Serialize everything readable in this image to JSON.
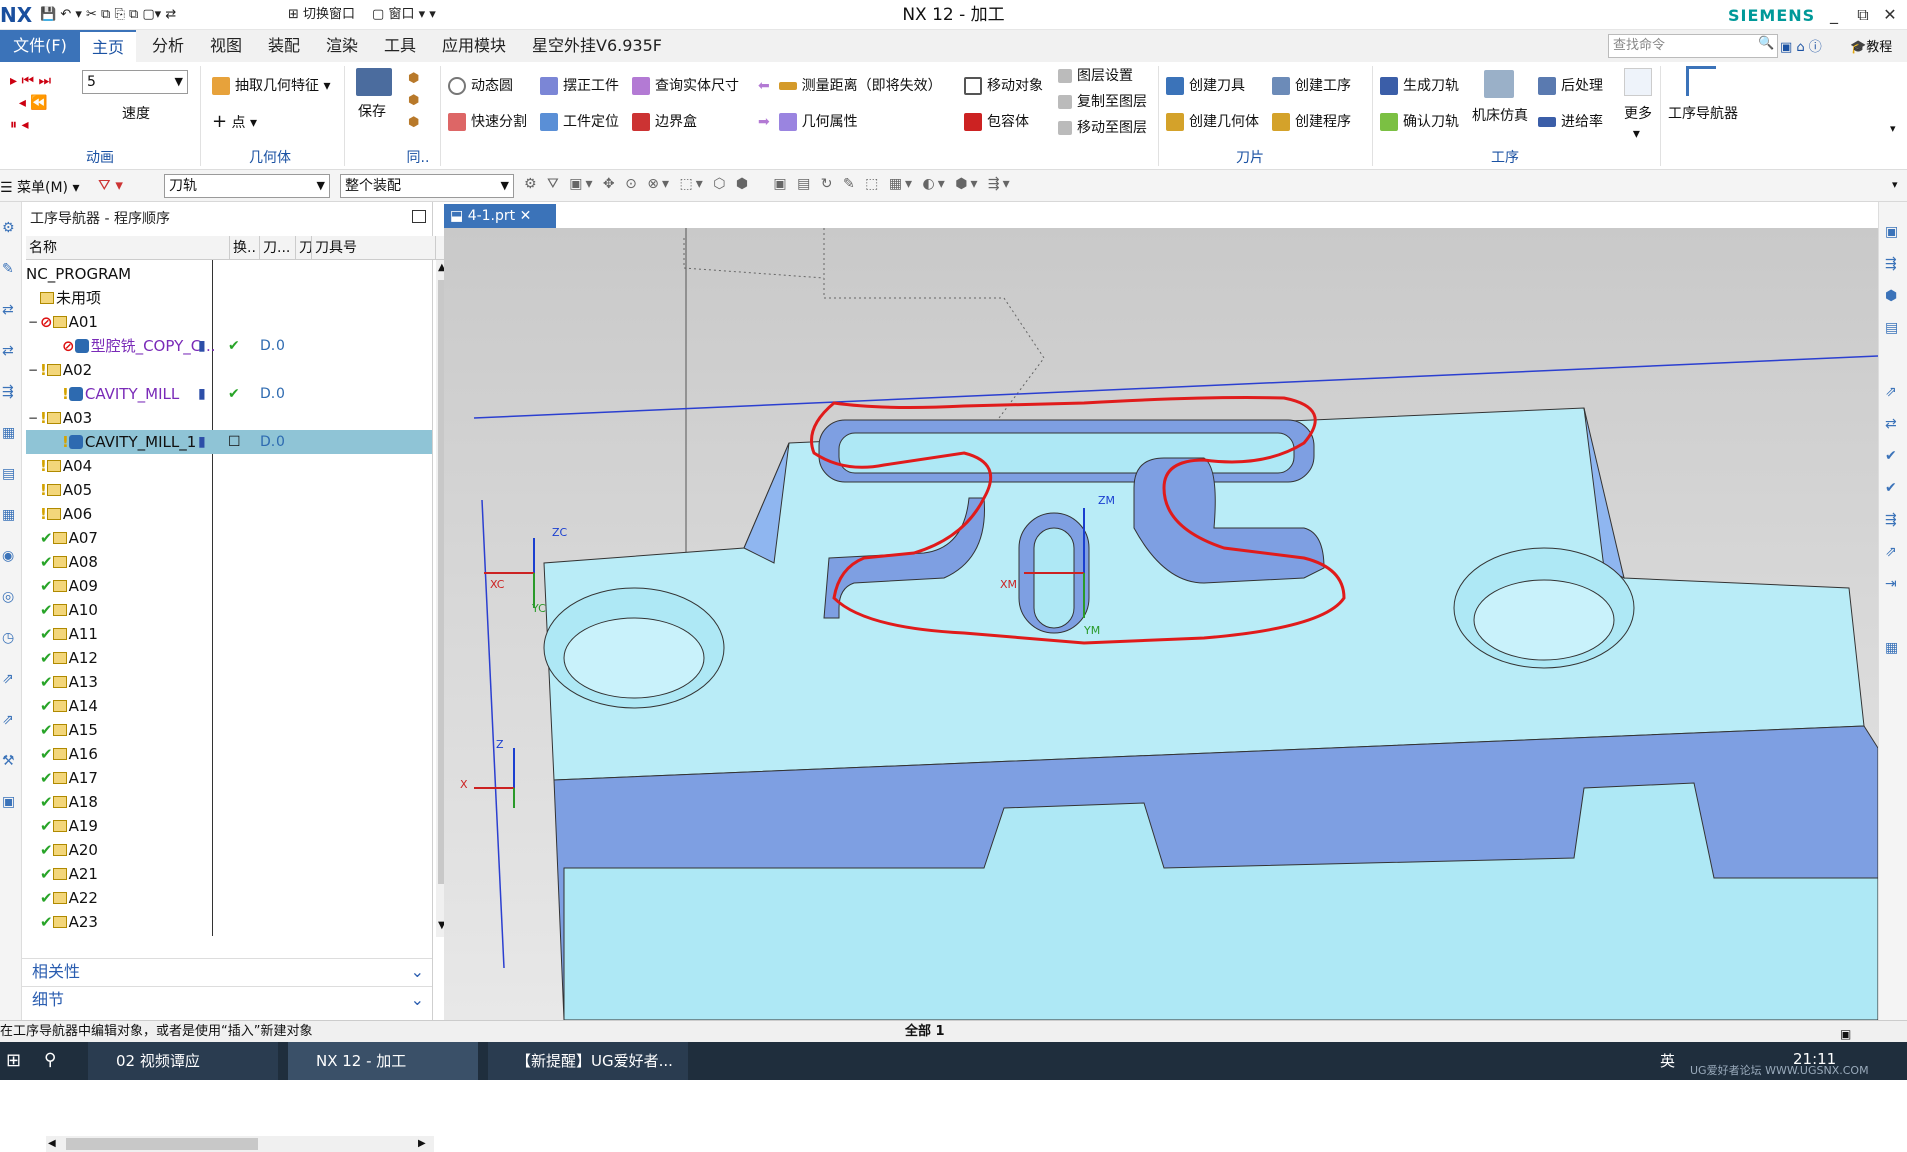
{
  "titlebar": {
    "logo": "NX",
    "switch_window": "切换窗口",
    "window_menu": "窗口",
    "title": "NX 12 - 加工",
    "brand": "SIEMENS",
    "minimize": "_",
    "restore": "⧉",
    "close": "✕"
  },
  "menu": {
    "file": "文件(F)",
    "tabs": [
      "主页",
      "分析",
      "视图",
      "装配",
      "渲染",
      "工具",
      "应用模块",
      "星空外挂V6.935F"
    ],
    "search_placeholder": "查找命令",
    "tutorial": "教程"
  },
  "ribbon": {
    "animation": {
      "speed_value": "5",
      "speed_label": "速度",
      "group": "动画"
    },
    "geometry": {
      "extract": "抽取几何特征",
      "point": "点",
      "group": "几何体"
    },
    "save": "保存",
    "sync_group": "同..",
    "tools": {
      "dynamic_circle": "动态圆",
      "place_part": "摆正工件",
      "query_size": "查询实体尺寸",
      "measure_distance": "测量距离（即将失效）",
      "move_object": "移动对象",
      "layer_settings": "图层设置",
      "quick_split": "快速分割",
      "part_locate": "工件定位",
      "bounding_box": "边界盒",
      "geom_props": "几何属性",
      "wrap_body": "包容体",
      "copy_to_layer": "复制至图层",
      "move_to_layer": "移动至图层"
    },
    "tool_group": {
      "create_tool": "创建刀具",
      "create_geometry": "创建几何体",
      "group": "刀片"
    },
    "operation": {
      "create_operation": "创建工序",
      "create_program": "创建程序",
      "generate_toolpath": "生成刀轨",
      "verify_toolpath": "确认刀轨",
      "machine_sim": "机床仿真",
      "postprocess": "后处理",
      "feed_rate": "进给率",
      "more": "更多",
      "group": "工序"
    },
    "navigator": "工序导航器"
  },
  "toolbar2": {
    "menu": "菜单(M)",
    "filter": "刀轨",
    "assembly": "整个装配"
  },
  "navigator": {
    "title": "工序导航器 - 程序顺序",
    "columns": [
      "名称",
      "换..",
      "刀...",
      "刀",
      "刀具号"
    ],
    "rows": [
      {
        "name": "NC_PROGRAM",
        "indent": 0,
        "kind": "root"
      },
      {
        "name": "未用项",
        "indent": 1,
        "kind": "folder"
      },
      {
        "name": "A01",
        "indent": 1,
        "kind": "folder",
        "status": "no",
        "expand": "−"
      },
      {
        "name": "型腔铣_COPY_C...",
        "indent": 2,
        "kind": "op",
        "status": "no",
        "tool_change": "▮",
        "path": "✔",
        "col3": "D.",
        "tool_no": "0",
        "purple": true
      },
      {
        "name": "A02",
        "indent": 1,
        "kind": "folder",
        "status": "warn",
        "expand": "−"
      },
      {
        "name": "CAVITY_MILL",
        "indent": 2,
        "kind": "op",
        "status": "warn",
        "tool_change": "▮",
        "path": "✔",
        "col3": "D.",
        "tool_no": "0",
        "purple": true
      },
      {
        "name": "A03",
        "indent": 1,
        "kind": "folder",
        "status": "warn",
        "expand": "−"
      },
      {
        "name": "CAVITY_MILL_1",
        "indent": 2,
        "kind": "op",
        "status": "warn",
        "tool_change": "▮",
        "path": "☐",
        "col3": "D.",
        "tool_no": "0",
        "selected": true
      },
      {
        "name": "A04",
        "indent": 1,
        "kind": "folder",
        "status": "warn"
      },
      {
        "name": "A05",
        "indent": 1,
        "kind": "folder",
        "status": "warn"
      },
      {
        "name": "A06",
        "indent": 1,
        "kind": "folder",
        "status": "warn"
      },
      {
        "name": "A07",
        "indent": 1,
        "kind": "folder",
        "status": "ok"
      },
      {
        "name": "A08",
        "indent": 1,
        "kind": "folder",
        "status": "ok"
      },
      {
        "name": "A09",
        "indent": 1,
        "kind": "folder",
        "status": "ok"
      },
      {
        "name": "A10",
        "indent": 1,
        "kind": "folder",
        "status": "ok"
      },
      {
        "name": "A11",
        "indent": 1,
        "kind": "folder",
        "status": "ok"
      },
      {
        "name": "A12",
        "indent": 1,
        "kind": "folder",
        "status": "ok"
      },
      {
        "name": "A13",
        "indent": 1,
        "kind": "folder",
        "status": "ok"
      },
      {
        "name": "A14",
        "indent": 1,
        "kind": "folder",
        "status": "ok"
      },
      {
        "name": "A15",
        "indent": 1,
        "kind": "folder",
        "status": "ok"
      },
      {
        "name": "A16",
        "indent": 1,
        "kind": "folder",
        "status": "ok"
      },
      {
        "name": "A17",
        "indent": 1,
        "kind": "folder",
        "status": "ok"
      },
      {
        "name": "A18",
        "indent": 1,
        "kind": "folder",
        "status": "ok"
      },
      {
        "name": "A19",
        "indent": 1,
        "kind": "folder",
        "status": "ok"
      },
      {
        "name": "A20",
        "indent": 1,
        "kind": "folder",
        "status": "ok"
      },
      {
        "name": "A21",
        "indent": 1,
        "kind": "folder",
        "status": "ok"
      },
      {
        "name": "A22",
        "indent": 1,
        "kind": "folder",
        "status": "ok"
      },
      {
        "name": "A23",
        "indent": 1,
        "kind": "folder",
        "status": "ok"
      }
    ],
    "dependencies": "相关性",
    "details": "细节"
  },
  "viewport": {
    "tab": "4-1.prt",
    "axes": {
      "zc": "ZC",
      "xc": "XC",
      "yc": "YC",
      "zm": "ZM",
      "xm": "XM",
      "ym": "YM",
      "z": "Z",
      "x": "X"
    }
  },
  "status": {
    "hint": "在工序导航器中编辑对象，或者是使用“插入”新建对象",
    "selection": "全部 1"
  },
  "taskbar": {
    "items": [
      "02 视频谭应",
      "NX 12 - 加工",
      "【新提醒】UG爱好者..."
    ],
    "ime": "英",
    "clock": "21:11",
    "watermark": "UG爱好者论坛 WWW.UGSNX.COM"
  },
  "colors": {
    "accent": "#3b73b9",
    "part_face": "#aee8f5",
    "part_side": "#7a9fe0",
    "annotation": "#e01b1b"
  }
}
